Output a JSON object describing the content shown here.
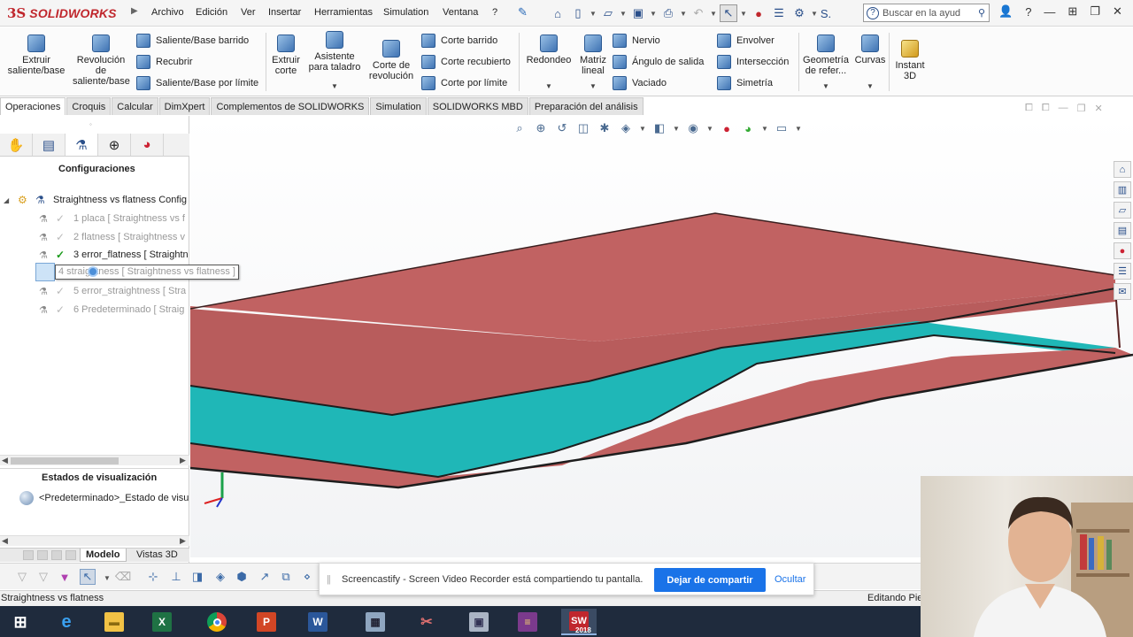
{
  "app": {
    "logo_ds": "3S",
    "logo_text": "SOLIDWORKS"
  },
  "menu": [
    "Archivo",
    "Edición",
    "Ver",
    "Insertar",
    "Herramientas",
    "Simulation",
    "Ventana",
    "?"
  ],
  "search": {
    "placeholder": "Buscar en la ayud",
    "s_label": "S..."
  },
  "ribbon": {
    "extrude_boss": "Extruir saliente/base",
    "revolve_boss": "Revolución de saliente/base",
    "swept_boss": "Saliente/Base barrido",
    "wrap_cut_recubrir": "Recubrir",
    "boundary_boss": "Saliente/Base por límite",
    "extrude_cut": "Extruir corte",
    "hole_wizard": "Asistente para taladro",
    "revolve_cut": "Corte de revolución",
    "swept_cut": "Corte barrido",
    "lofted_cut": "Corte recubierto",
    "boundary_cut": "Corte por límite",
    "fillet": "Redondeo",
    "linear_pattern": "Matriz lineal",
    "rib": "Nervio",
    "draft": "Ángulo de salida",
    "shell": "Vaciado",
    "wrap": "Envolver",
    "intersect": "Intersección",
    "mirror": "Simetría",
    "ref_geometry": "Geometría de refer...",
    "curves": "Curvas",
    "instant3d": "Instant 3D"
  },
  "command_tabs": [
    "Operaciones",
    "Croquis",
    "Calcular",
    "DimXpert",
    "Complementos de SOLIDWORKS",
    "Simulation",
    "SOLIDWORKS MBD",
    "Preparación del análisis"
  ],
  "left_pane": {
    "section_title": "Configuraciones",
    "root": "Straightness vs flatness Config",
    "items": [
      {
        "label": "1 placa [ Straightness vs f",
        "active": false
      },
      {
        "label": "2 flatness [ Straightness v",
        "active": false
      },
      {
        "label": "3 error_flatness [ Straightn",
        "active": true
      },
      {
        "label": "5 error_straightness [ Stra",
        "active": false
      },
      {
        "label": "6 Predeterminado [ Straig",
        "active": false
      }
    ],
    "editing_item": "4 straightness [ Straightness vs flatness ]",
    "display_states_title": "Estados de visualización",
    "display_state": "<Predeterminado>_Estado de visu"
  },
  "model_tabs": [
    "Modelo",
    "Vistas 3D"
  ],
  "status": {
    "left": "Straightness vs flatness",
    "right": "Editando Pie"
  },
  "notification": {
    "message": "Screencastify - Screen Video Recorder está compartiendo tu pantalla.",
    "stop_button": "Dejar de compartir",
    "hide_link": "Ocultar"
  },
  "taskbar": [
    "start-icon",
    "edge-icon",
    "explorer-icon",
    "excel-icon",
    "chrome-icon",
    "powerpoint-icon",
    "word-icon",
    "calculator-icon",
    "snipping-icon",
    "photos-icon",
    "winrar-icon",
    "solidworks-icon"
  ],
  "colors": {
    "plate_top": "#c16262",
    "plate_side": "#b85c5c",
    "gap_fill": "#1fb7b7",
    "accent_blue": "#1a73e8",
    "sw_red": "#c0272d"
  },
  "taskbar_sw_badge": "2018"
}
